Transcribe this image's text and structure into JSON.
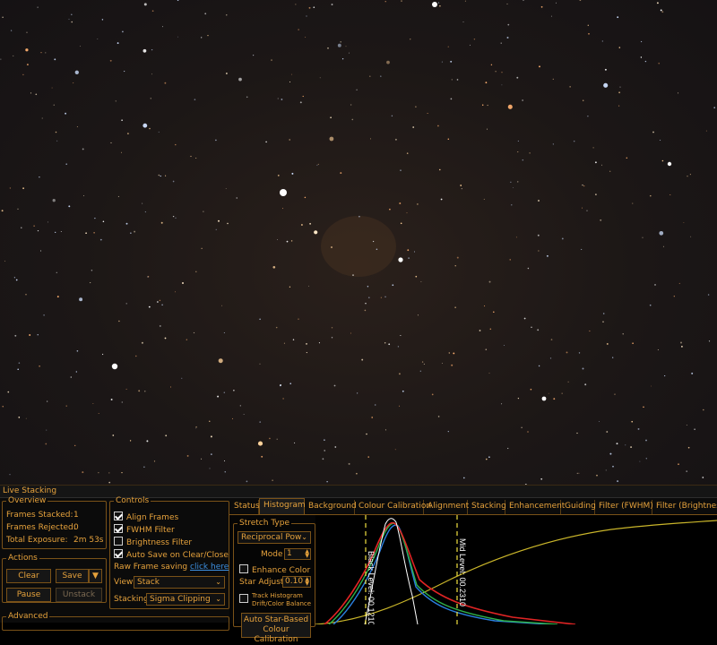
{
  "window": {
    "title": "Live Stacking"
  },
  "overview": {
    "legend": "Overview",
    "frames_stacked_label": "Frames Stacked:",
    "frames_stacked_value": "1",
    "frames_rejected_label": "Frames Rejected:",
    "frames_rejected_value": "0",
    "total_exposure_label": "Total Exposure:",
    "total_exposure_value": "2m 53s"
  },
  "actions": {
    "legend": "Actions",
    "clear": "Clear",
    "save": "Save",
    "pause": "Pause",
    "unstack": "Unstack"
  },
  "advanced": {
    "legend": "Advanced"
  },
  "controls": {
    "legend": "Controls",
    "align_frames": "Align Frames",
    "fwhm_filter": "FWHM Filter",
    "brightness_filter": "Brightness Filter",
    "auto_save": "Auto Save on Clear/Close",
    "raw_frame_saving_label": "Raw Frame saving",
    "raw_frame_saving_link": "click here",
    "view_label": "View",
    "view_value": "Stack",
    "stacking_label": "Stacking",
    "stacking_value": "Sigma Clipping"
  },
  "tabs": [
    "Status",
    "Histogram",
    "Background",
    "Colour Calibration",
    "Alignment",
    "Stacking",
    "Enhancement",
    "Guiding",
    "Filter (FWHM)",
    "Filter (Brightness)"
  ],
  "active_tab": "Histogram",
  "histogram": {
    "stretch_legend": "Stretch Type",
    "stretch_value": "Reciprocal Pow",
    "mode_label": "Mode",
    "mode_value": "1",
    "enhance_color": "Enhance Color",
    "star_adjust_label": "Star Adjust",
    "star_adjust_value": "0.10",
    "track_histogram_line1": "Track Histogram",
    "track_histogram_line2": "Drift/Color Balance",
    "auto_button_line1": "Auto Star-Based",
    "auto_button_line2": "Colour Calibration",
    "black_level_label": "Black Level: 00.1210",
    "mid_level_label": "Mid Level: 00.2310"
  },
  "colors": {
    "accent": "#e6a23c",
    "link": "#3c8fe0",
    "marker": "#f0e040"
  },
  "icons": {
    "dropdown": "chevron-down-icon",
    "split": "triangle-down-icon",
    "spinner": "up-down-arrows-icon"
  }
}
